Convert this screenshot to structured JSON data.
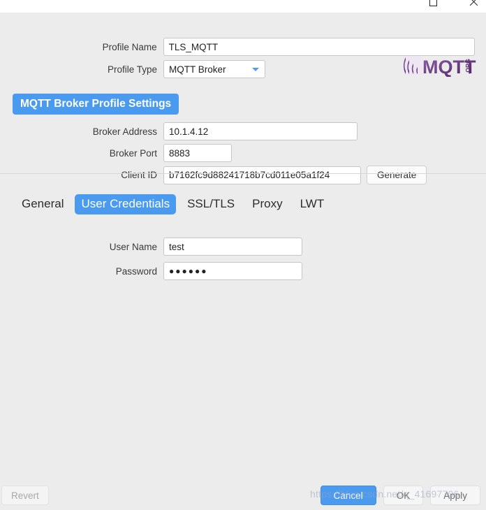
{
  "window": {
    "maximize_icon": "maximize-icon",
    "close_icon": "close-icon"
  },
  "profile": {
    "name_label": "Profile Name",
    "name_value": "TLS_MQTT",
    "type_label": "Profile Type",
    "type_value": "MQTT Broker",
    "type_options": [
      "MQTT Broker"
    ],
    "dropdown_icon": "chevron-down-icon"
  },
  "logo": {
    "name": "mqtt-org-logo",
    "text": "MQTT",
    "suffix": ".ORG"
  },
  "section": {
    "header_label": "MQTT Broker Profile Settings"
  },
  "broker": {
    "address_label": "Broker Address",
    "address_value": "10.1.4.12",
    "port_label": "Broker Port",
    "port_value": "8883",
    "client_id_label": "Client ID",
    "client_id_value": "b7162fc9d88241718b7cd011e05a1f24",
    "generate_label": "Generate"
  },
  "tabs": [
    {
      "label": "General",
      "active": false
    },
    {
      "label": "User Credentials",
      "active": true
    },
    {
      "label": "SSL/TLS",
      "active": false
    },
    {
      "label": "Proxy",
      "active": false
    },
    {
      "label": "LWT",
      "active": false
    }
  ],
  "credentials": {
    "user_name_label": "User Name",
    "user_name_value": "test",
    "password_label": "Password",
    "password_value": "●●●●●●"
  },
  "footer": {
    "revert_label": "Revert",
    "cancel_label": "Cancel",
    "ok_label": "OK",
    "apply_label": "Apply"
  },
  "watermark": {
    "text": "https://blog.csdn.net/q_41697706"
  },
  "colors": {
    "accent_blue": "#4a9bf0",
    "background_gray": "#ececec",
    "logo_purple": "#6d3a86"
  }
}
